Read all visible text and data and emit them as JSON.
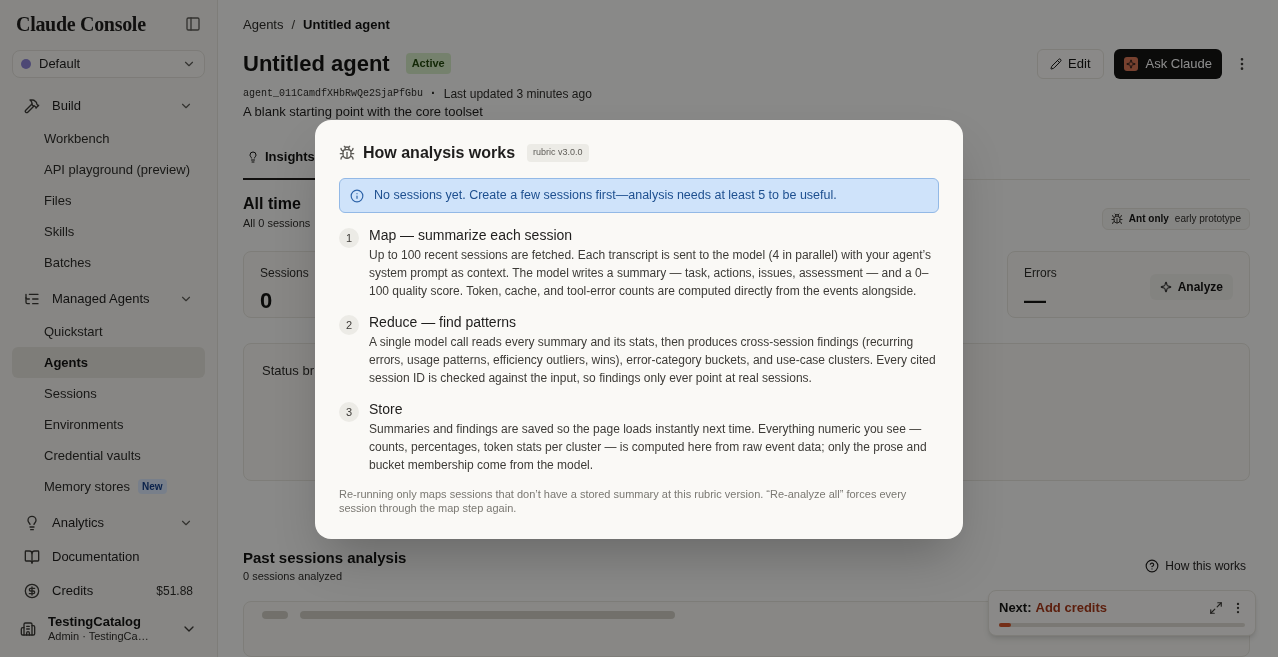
{
  "sidebar": {
    "logo": "Claude Console",
    "workspace": "Default",
    "sections": [
      {
        "label": "Build",
        "items": [
          {
            "label": "Workbench",
            "selected": false
          },
          {
            "label": "API playground (preview)",
            "selected": false
          },
          {
            "label": "Files",
            "selected": false
          },
          {
            "label": "Skills",
            "selected": false
          },
          {
            "label": "Batches",
            "selected": false
          }
        ]
      },
      {
        "label": "Managed Agents",
        "items": [
          {
            "label": "Quickstart",
            "selected": false
          },
          {
            "label": "Agents",
            "selected": true
          },
          {
            "label": "Sessions",
            "selected": false
          },
          {
            "label": "Environments",
            "selected": false
          },
          {
            "label": "Credential vaults",
            "selected": false
          },
          {
            "label": "Memory stores",
            "selected": false,
            "badge": "New"
          }
        ]
      },
      {
        "label": "Analytics"
      }
    ],
    "links": [
      {
        "label": "Documentation"
      },
      {
        "label": "Credits",
        "value": "$51.88"
      }
    ],
    "account": {
      "name": "TestingCatalog",
      "detail": "Admin · TestingCa…"
    }
  },
  "header": {
    "breadcrumb": [
      "Agents",
      "Untitled agent"
    ],
    "breadcrumb_separator": "/",
    "title": "Untitled agent",
    "status": "Active",
    "agent_id": "agent_011CamdfXHbRwQe2SjaPfGbu",
    "meta_separator": "·",
    "updated": "Last updated 3 minutes ago",
    "description": "A blank starting point with the core toolset",
    "edit_button": "Edit",
    "ask_button": "Ask Claude"
  },
  "tabs": [
    {
      "label": "Insights",
      "selected": true
    }
  ],
  "insights": {
    "title": "All time",
    "subtitle": "All 0 sessions",
    "tag": {
      "label": "Ant only",
      "note": "early prototype"
    },
    "stats": [
      {
        "label": "Sessions",
        "value": "0"
      },
      {
        "label": "Errors",
        "value": "—"
      }
    ],
    "analyze_button": "Analyze",
    "status_panel": {
      "title": "Status br"
    }
  },
  "past_analysis": {
    "title": "Past sessions analysis",
    "subtitle": "0 sessions analyzed",
    "help_button": "How this works"
  },
  "next_card": {
    "label": "Next:",
    "action": "Add credits",
    "level": 0.05
  },
  "modal": {
    "title": "How analysis works",
    "version": "rubric v3.0.0",
    "notice": "No sessions yet. Create a few sessions first—analysis needs at least 5 to be useful.",
    "steps": [
      {
        "number": "1",
        "title": "Map — summarize each session",
        "body": "Up to 100 recent sessions are fetched. Each transcript is sent to the model (4 in parallel) with your agent’s system prompt as context. The model writes a summary — task, actions, issues, assessment — and a 0–100 quality score. Token, cache, and tool-error counts are computed directly from the events alongside."
      },
      {
        "number": "2",
        "title": "Reduce — find patterns",
        "body": "A single model call reads every summary and its stats, then produces cross-session findings (recurring errors, usage patterns, efficiency outliers, wins), error-category buckets, and use-case clusters. Every cited session ID is checked against the input, so findings only ever point at real sessions."
      },
      {
        "number": "3",
        "title": "Store",
        "body": "Summaries and findings are saved so the page loads instantly next time. Everything numeric you see — counts, percentages, token stats per cluster — is computed here from raw event data; only the prose and bucket membership come from the model."
      }
    ],
    "footnote": "Re-running only maps sessions that don’t have a stored summary at this rubric version. “Re-analyze all” forces every session through the map step again."
  }
}
